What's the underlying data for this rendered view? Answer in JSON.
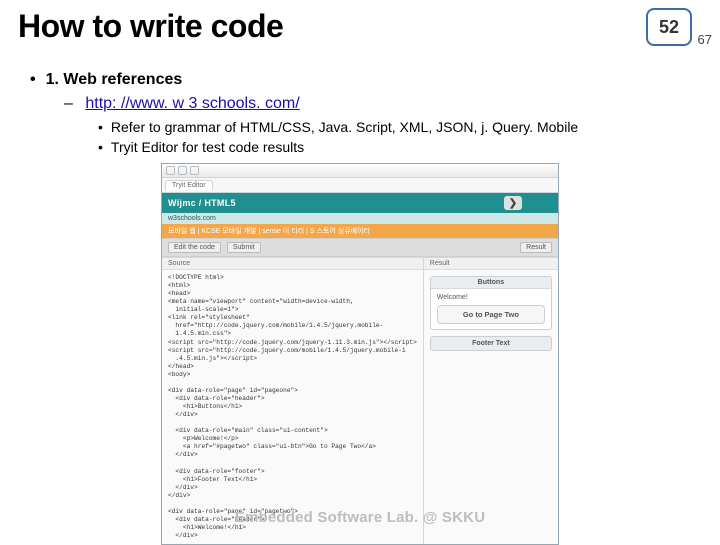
{
  "page": {
    "number": "52",
    "sub": "67"
  },
  "title": "How to write code",
  "bullets": {
    "l1": "1. Web references",
    "l2_link": "http: //www. w 3 schools. com/",
    "l3a": "Refer to grammar of HTML/CSS, Java. Script, XML, JSON, j. Query. Mobile",
    "l3b": "Tryit Editor for test code results"
  },
  "screenshot": {
    "tab": "Tryit Editor",
    "brand": "Wijmc / HTML5",
    "chevron": "❯",
    "subhead": "w3schools.com",
    "orange": "모바일 웹 | KCSE 모바일 개발 | sense 이 티리 | S 스토어 싱큐에이터",
    "toolbar": {
      "a": "Edit the code",
      "b": "Submit",
      "c": "Result"
    },
    "pane_source": "Source",
    "pane_result": "Result",
    "code": "<!DOCTYPE html>\n<html>\n<head>\n<meta name=\"viewport\" content=\"width=device-width,\n  initial-scale=1\">\n<link rel=\"stylesheet\"\n  href=\"http://code.jquery.com/mobile/1.4.5/jquery.mobile-\n  1.4.5.min.css\">\n<script src=\"http://code.jquery.com/jquery-1.11.3.min.js\"></script>\n<script src=\"http://code.jquery.com/mobile/1.4.5/jquery.mobile-1\n  .4.5.min.js\"></script>\n</head>\n<body>\n\n<div data-role=\"page\" id=\"pageone\">\n  <div data-role=\"header\">\n    <h1>Buttons</h1>\n  </div>\n\n  <div data-role=\"main\" class=\"ui-content\">\n    <p>Welcome!</p>\n    <a href=\"#pagetwo\" class=\"ui-btn\">Go to Page Two</a>\n  </div>\n\n  <div data-role=\"footer\">\n    <h1>Footer Text</h1>\n  </div>\n</div>\n\n<div data-role=\"page\" id=\"pagetwo\">\n  <div data-role=\"header\">\n    <h1>Welcome!</h1>\n  </div>",
    "result": {
      "header": "Buttons",
      "text": "Welcome!",
      "button": "Go to Page Two",
      "footer": "Footer Text"
    }
  },
  "footer": "Embedded Software Lab. @ SKKU"
}
